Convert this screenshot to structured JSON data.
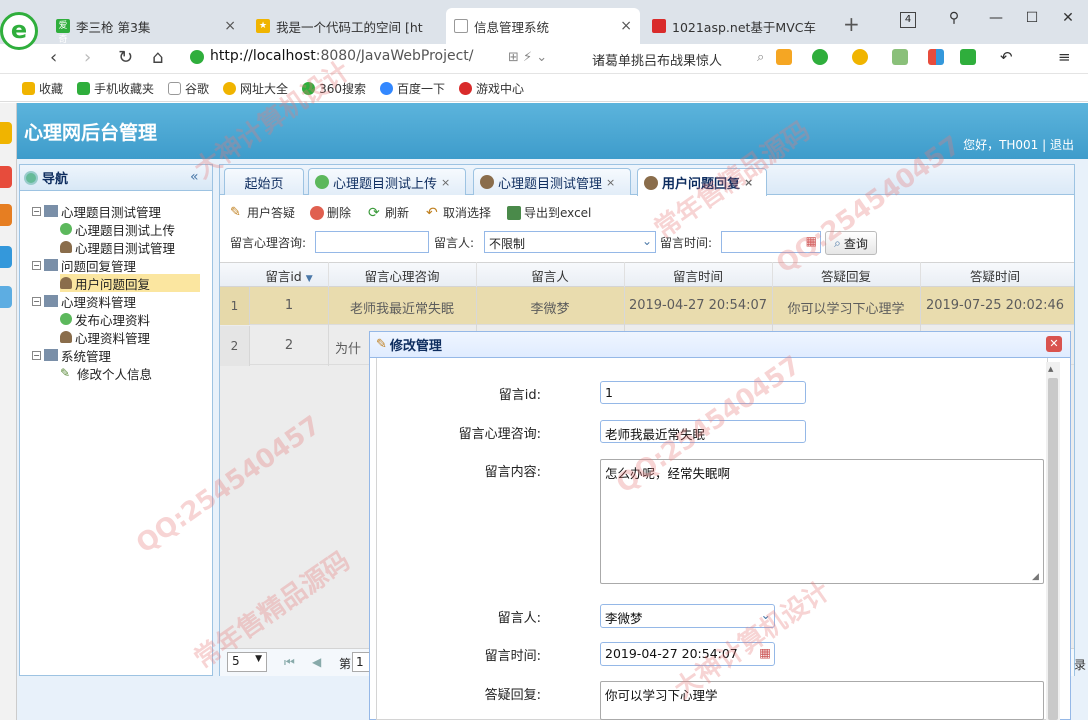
{
  "browser": {
    "tabs": [
      {
        "title": "李三枪 第3集",
        "fav_color": "#2fae3c",
        "fav_text": "爱奇"
      },
      {
        "title": "我是一个代码工的空间 [ht",
        "fav_color": "#f0b400",
        "fav_text": "★"
      },
      {
        "title": "信息管理系统",
        "fav_color": "#ffffff",
        "fav_text": ""
      },
      {
        "title": "1021asp.net基于MVC车",
        "fav_color": "#d92b2b",
        "fav_text": ""
      }
    ],
    "tab_close": "×",
    "new_tab": "+",
    "counter": "4",
    "url_host": "http://localhost",
    "url_rest": ":8080/JavaWebProject/",
    "search_text": "诸葛单挑吕布战果惊人",
    "bookmarks": [
      "收藏",
      "手机收藏夹",
      "谷歌",
      "网址大全",
      "360搜索",
      "百度一下",
      "游戏中心"
    ]
  },
  "app": {
    "title": "心理网后台管理",
    "greeting": "您好，TH001 | 退出"
  },
  "nav": {
    "title": "导航",
    "collapse": "«",
    "tree": [
      {
        "label": "心理题目测试管理",
        "level": 0
      },
      {
        "label": "心理题目测试上传",
        "level": 1
      },
      {
        "label": "心理题目测试管理",
        "level": 1
      },
      {
        "label": "问题回复管理",
        "level": 0
      },
      {
        "label": "用户问题回复",
        "level": 1,
        "selected": true
      },
      {
        "label": "心理资料管理",
        "level": 0
      },
      {
        "label": "发布心理资料",
        "level": 1
      },
      {
        "label": "心理资料管理",
        "level": 1
      },
      {
        "label": "系统管理",
        "level": 0
      },
      {
        "label": "修改个人信息",
        "level": 1
      }
    ]
  },
  "tabs": [
    {
      "label": "起始页",
      "close": ""
    },
    {
      "label": "心理题目测试上传",
      "close": "×"
    },
    {
      "label": "心理题目测试管理",
      "close": "×"
    },
    {
      "label": "用户问题回复",
      "close": "×"
    }
  ],
  "toolbar": {
    "answer": "用户答疑",
    "delete": "删除",
    "refresh": "刷新",
    "cancel": "取消选择",
    "export": "导出到excel"
  },
  "filter": {
    "consult_label": "留言心理咨询:",
    "user_label": "留言人:",
    "user_value": "不限制",
    "time_label": "留言时间:",
    "query": "查询"
  },
  "grid": {
    "columns": [
      "留言id",
      "留言心理咨询",
      "留言人",
      "留言时间",
      "答疑回复",
      "答疑时间"
    ],
    "sort_arrow": "▼",
    "rows": [
      {
        "rn": "1",
        "id": "1",
        "consult": "老师我最近常失眠",
        "user": "李微梦",
        "time": "2019-04-27 20:54:07",
        "reply": "你可以学习下心理学",
        "reply_time": "2019-07-25 20:02:46"
      },
      {
        "rn": "2",
        "id": "2",
        "consult": "为什",
        "user": "",
        "time": "",
        "reply": "",
        "reply_time": ""
      }
    ]
  },
  "pager": {
    "page_size": "5",
    "page_prefix": "第",
    "page_value": "1",
    "right_fragment": "录"
  },
  "modal": {
    "title": "修改管理",
    "close": "✕",
    "fields": {
      "id_label": "留言id:",
      "id_value": "1",
      "consult_label": "留言心理咨询:",
      "consult_value": "老师我最近常失眠",
      "content_label": "留言内容:",
      "content_value": "怎么办呢，经常失眠啊",
      "user_label": "留言人:",
      "user_value": "李微梦",
      "time_label": "留言时间:",
      "time_value": "2019-04-27 20:54:07",
      "reply_label": "答疑回复:",
      "reply_value": "你可以学习下心理学"
    }
  },
  "watermarks": [
    "QQ:254540457",
    "常年售精品源码",
    "大神计算机设计"
  ]
}
